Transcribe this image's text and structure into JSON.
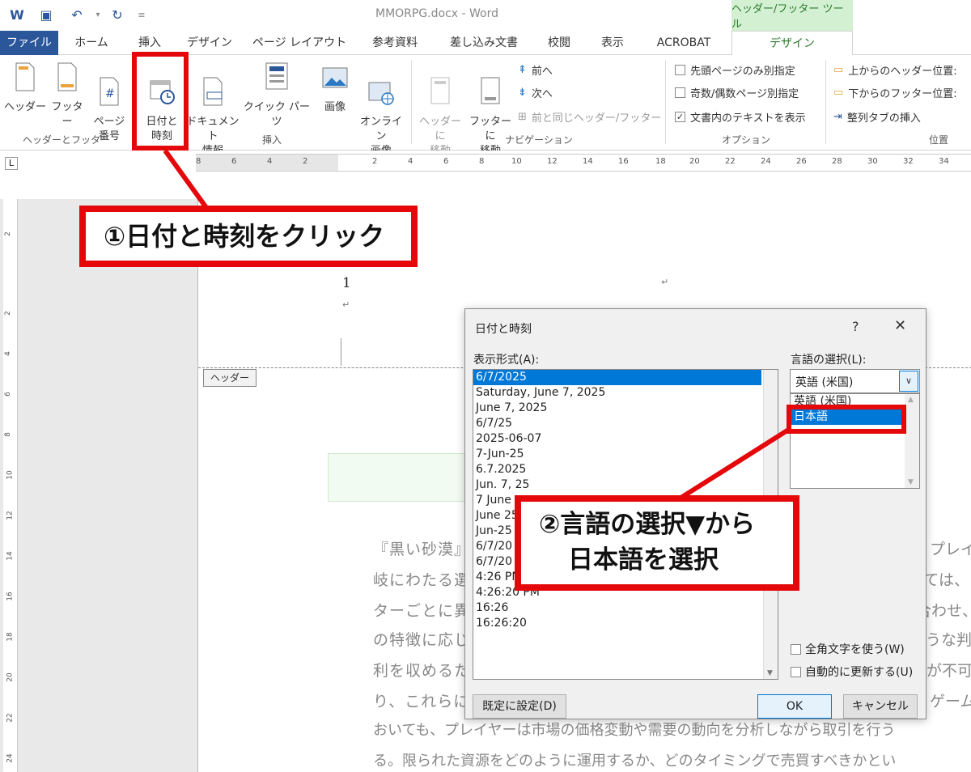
{
  "title_bar": {
    "document_title": "MMORPG.docx - Word",
    "contextual_tools": "ヘッダー/フッター ツール"
  },
  "tabs": [
    "ファイル",
    "ホーム",
    "挿入",
    "デザイン",
    "ページ レイアウト",
    "参考資料",
    "差し込み文書",
    "校閲",
    "表示",
    "ACROBAT",
    "デザイン"
  ],
  "ribbon": {
    "buttons": {
      "header": "ヘッダー",
      "footer": "フッター",
      "page_number": "ページ\n番号",
      "date_time": "日付と\n時刻",
      "doc_info": "ドキュメント\n情報",
      "quick_parts": "クイック パーツ",
      "picture": "画像",
      "online_picture": "オンライン\n画像",
      "goto_header": "ヘッダーに\n移動",
      "goto_footer": "フッターに\n移動",
      "prev": "前へ",
      "next": "次へ",
      "link_prev": "前と同じヘッダー/フッター",
      "diff_first": "先頭ページのみ別指定",
      "diff_odd_even": "奇数/偶数ページ別指定",
      "show_text": "文書内のテキストを表示",
      "header_pos": "上からのヘッダー位置:",
      "footer_pos": "下からのフッター位置:",
      "align_tab": "整列タブの挿入"
    },
    "groups": {
      "header_footer": "ヘッダーとフッター",
      "insert": "挿入",
      "navigation": "ナビゲーション",
      "options": "オプション",
      "position": "位置"
    }
  },
  "ruler": {
    "h_ticks": [
      "8",
      "6",
      "4",
      "2",
      "2",
      "4",
      "6",
      "8",
      "10",
      "12",
      "14",
      "16",
      "18",
      "20",
      "22",
      "24",
      "26",
      "28",
      "30",
      "32",
      "34"
    ],
    "v_ticks": [
      "2",
      "2",
      "4",
      "6",
      "8",
      "10",
      "12",
      "14",
      "16",
      "18",
      "20",
      "22",
      "24"
    ]
  },
  "document": {
    "page_number": "1",
    "header_tag": "ヘッダー",
    "lines_left": [
      "『黒い砂漠』",
      "岐にわたる選",
      "ターごとに異",
      "の特徴に応じ",
      "利を収めるた",
      "り、これらに",
      "おいても、プレイヤーは市場の価格変動や需要の動向を分析しながら取引を行う",
      "る。限られた資源をどのように運用するか、どのタイミングで売買すべきかとい"
    ],
    "lines_right": [
      "プレイ",
      "いては、",
      "み合わせ、",
      "ような判",
      "が不可",
      "ゲーム"
    ]
  },
  "dialog": {
    "title": "日付と時刻",
    "help": "?",
    "close": "✕",
    "format_label": "表示形式(A):",
    "formats": [
      "6/7/2025",
      "Saturday, June 7, 2025",
      "June 7, 2025",
      "6/7/25",
      "2025-06-07",
      "7-Jun-25",
      "6.7.2025",
      "Jun. 7, 25",
      "7 June",
      "June 25",
      "Jun-25",
      "6/7/20",
      "6/7/20",
      "4:26 PM",
      "4:26:20 PM",
      "16:26",
      "16:26:20"
    ],
    "language_label": "言語の選択(L):",
    "language_selected": "英語 (米国)",
    "languages": [
      "英語 (米国)",
      "日本語"
    ],
    "use_fullwidth": "全角文字を使う(W)",
    "auto_update": "自動的に更新する(U)",
    "set_default": "既定に設定(D)",
    "ok": "OK",
    "cancel": "キャンセル"
  },
  "annotations": {
    "step1": "①日付と時刻をクリック",
    "step2_line1": "②言語の選択▼から",
    "step2_line2": "日本語を選択"
  },
  "colors": {
    "file_tab": "#2b579a",
    "contextual": "#d3f0d3",
    "highlight": "#e4080a",
    "selection": "#0078d7"
  }
}
